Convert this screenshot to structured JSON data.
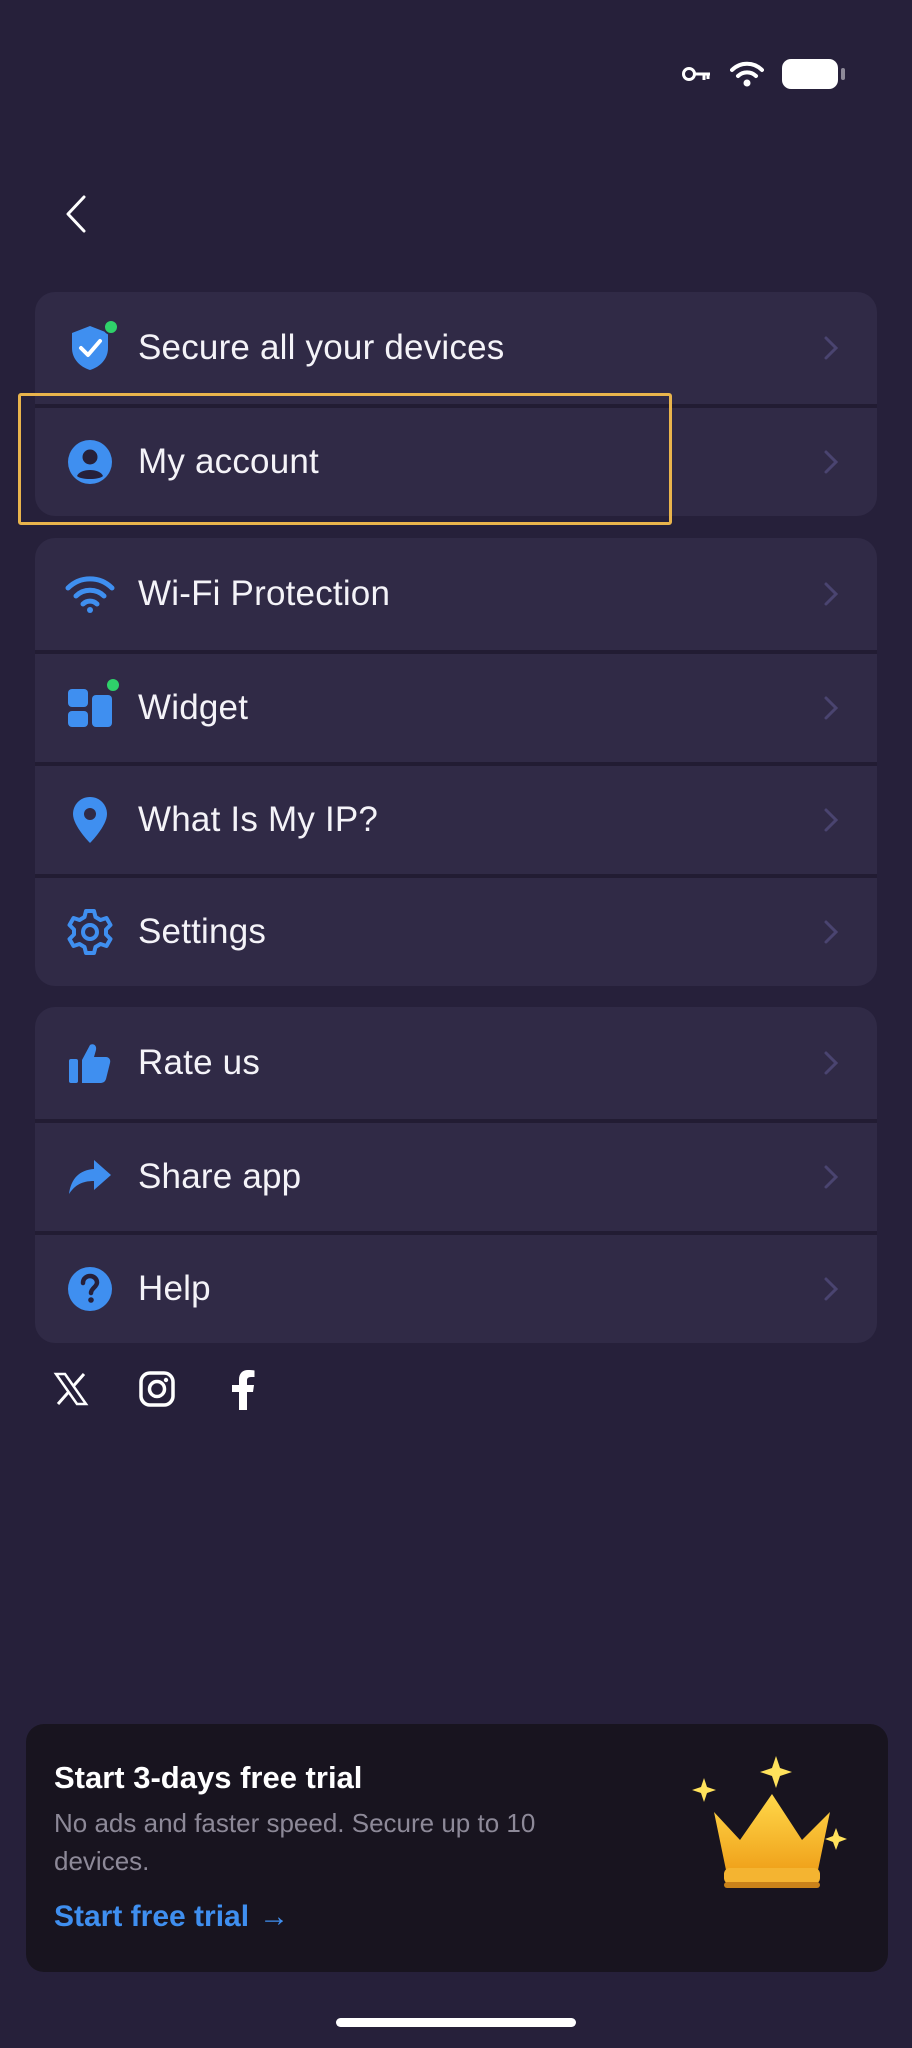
{
  "status_bar": {
    "icons": [
      "vpn-key-icon",
      "wifi-icon",
      "battery-icon"
    ]
  },
  "nav": {
    "back_icon": "chevron-left-icon"
  },
  "menu": {
    "group1": [
      {
        "label": "Secure all your devices",
        "icon": "shield-check-icon",
        "badge": "new-dot"
      },
      {
        "label": "My account",
        "icon": "user-circle-icon"
      }
    ],
    "group2": [
      {
        "label": "Wi-Fi Protection",
        "icon": "wifi-icon"
      },
      {
        "label": "Widget",
        "icon": "widget-icon",
        "badge": "new-dot"
      },
      {
        "label": "What Is My IP?",
        "icon": "location-pin-icon"
      },
      {
        "label": "Settings",
        "icon": "gear-icon"
      }
    ],
    "group3": [
      {
        "label": "Rate us",
        "icon": "thumbs-up-icon"
      },
      {
        "label": "Share app",
        "icon": "share-arrow-icon"
      },
      {
        "label": "Help",
        "icon": "question-circle-icon"
      }
    ]
  },
  "socials": [
    "x-icon",
    "instagram-icon",
    "facebook-icon"
  ],
  "trial": {
    "title": "Start 3-days free trial",
    "description": "No ads and faster speed. Secure up to 10 devices.",
    "cta": "Start free trial",
    "cta_arrow": "→",
    "icon": "crown-icon"
  },
  "colors": {
    "background": "#26203a",
    "card": "#302a46",
    "accent": "#3f8ff0",
    "badge": "#2fd16a",
    "highlight": "#e9b44c"
  }
}
